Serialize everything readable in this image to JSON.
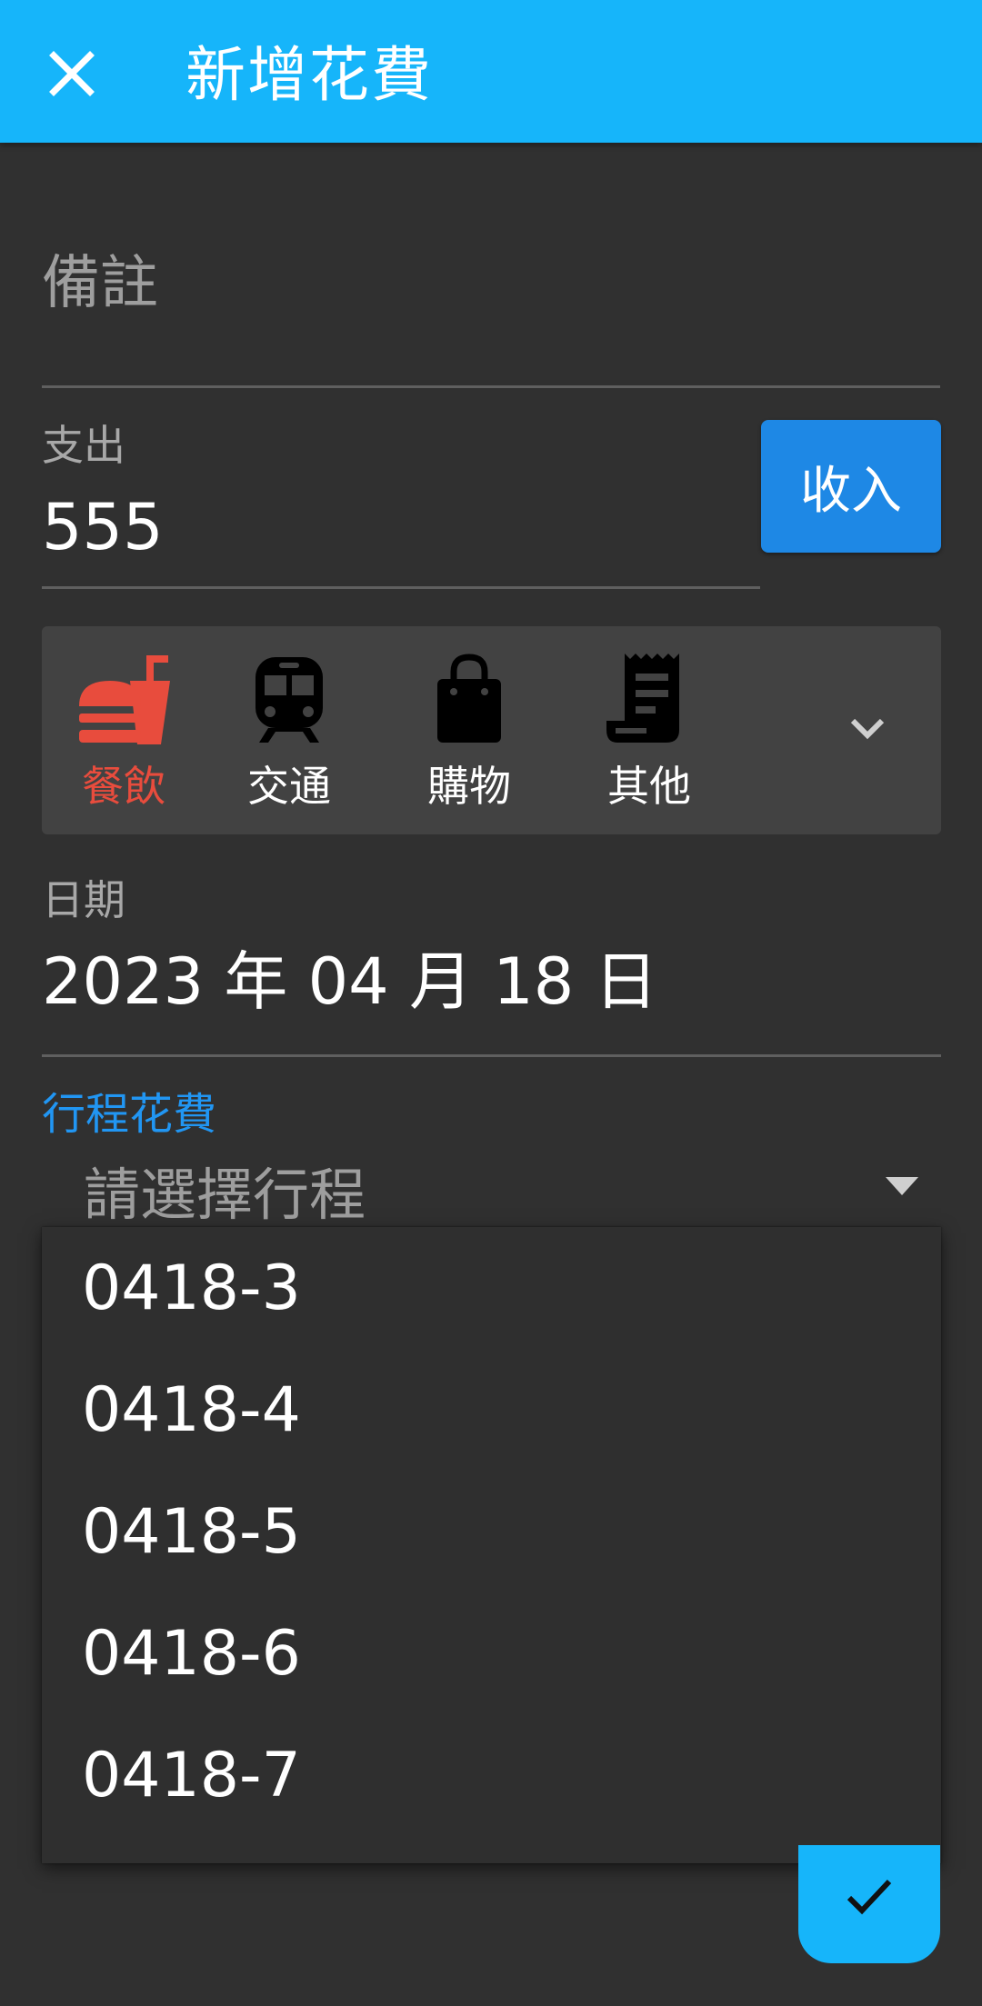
{
  "appbar": {
    "title": "新增花費",
    "close_icon": "close-icon"
  },
  "note": {
    "placeholder": "備註"
  },
  "amount": {
    "label": "支出",
    "value": "555"
  },
  "income_button": {
    "label": "收入"
  },
  "categories": [
    {
      "label": "餐飲",
      "icon": "fastfood-icon",
      "active": true,
      "color": "#e84c3d"
    },
    {
      "label": "交通",
      "icon": "train-icon",
      "active": false
    },
    {
      "label": "購物",
      "icon": "shopping-bag-icon",
      "active": false
    },
    {
      "label": "其他",
      "icon": "receipt-icon",
      "active": false
    }
  ],
  "date": {
    "label": "日期",
    "value": "2023 年 04 月 18 日"
  },
  "trip": {
    "label": "行程花費",
    "placeholder": "請選擇行程"
  },
  "trip_options": [
    "0418-3",
    "0418-4",
    "0418-5",
    "0418-6",
    "0418-7"
  ],
  "colors": {
    "appbar": "#16b5fa",
    "accent": "#1e88e5",
    "background": "#303030",
    "active_category": "#e84c3d"
  },
  "fab": {
    "icon": "check-icon"
  }
}
